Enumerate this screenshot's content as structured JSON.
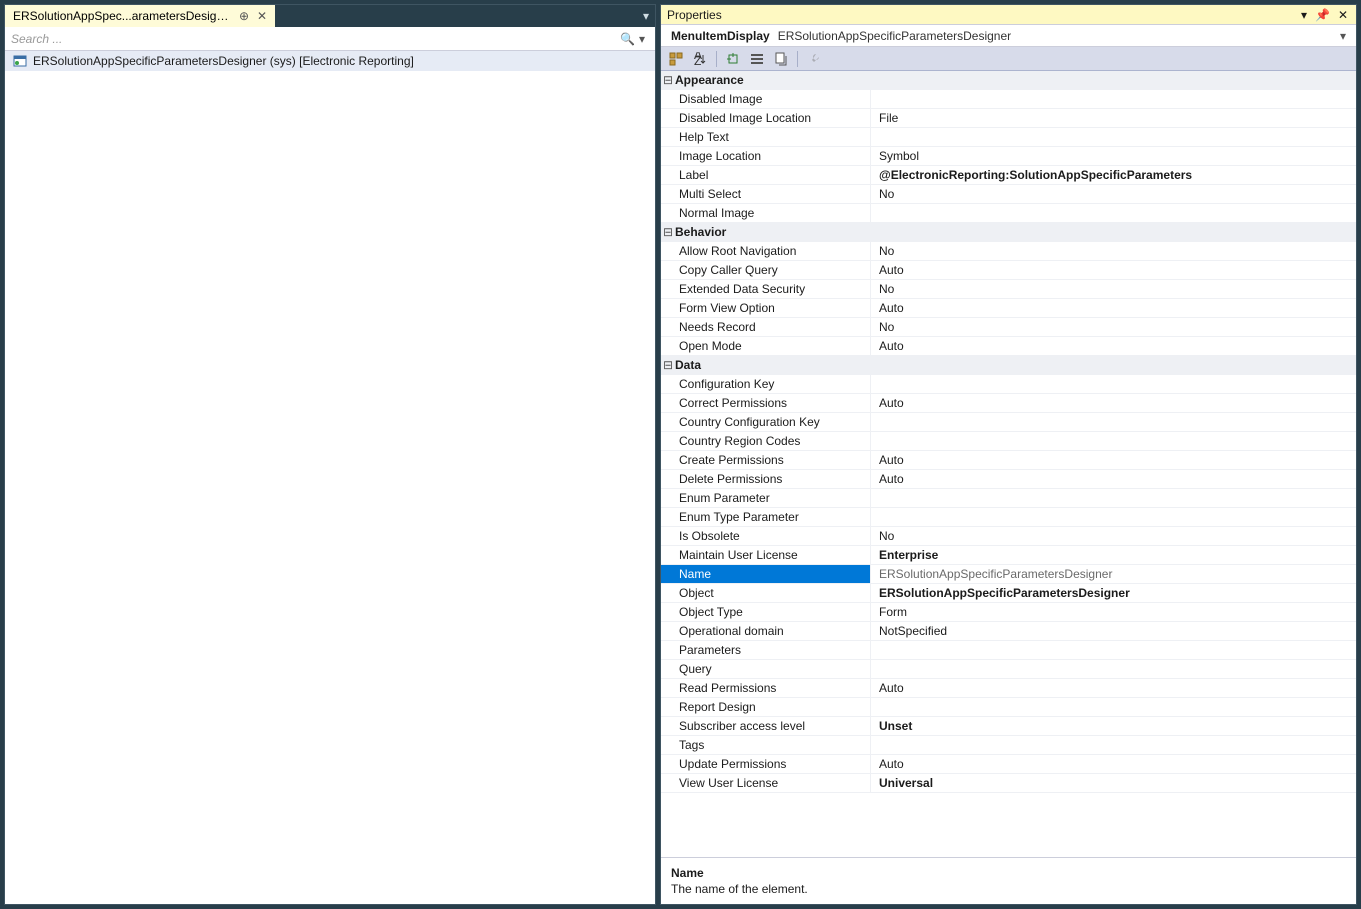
{
  "left": {
    "tab_title": "ERSolutionAppSpec...arametersDesigner",
    "search_placeholder": "Search ...",
    "tree_item": "ERSolutionAppSpecificParametersDesigner (sys) [Electronic Reporting]"
  },
  "props_title": "Properties",
  "hdr": {
    "type": "MenuItemDisplay",
    "name": "ERSolutionAppSpecificParametersDesigner"
  },
  "cats": [
    {
      "name": "Appearance",
      "rows": [
        {
          "k": "Disabled Image",
          "v": ""
        },
        {
          "k": "Disabled Image Location",
          "v": "File"
        },
        {
          "k": "Help Text",
          "v": ""
        },
        {
          "k": "Image Location",
          "v": "Symbol"
        },
        {
          "k": "Label",
          "v": "@ElectronicReporting:SolutionAppSpecificParameters",
          "b": true
        },
        {
          "k": "Multi Select",
          "v": "No"
        },
        {
          "k": "Normal Image",
          "v": ""
        }
      ]
    },
    {
      "name": "Behavior",
      "rows": [
        {
          "k": "Allow Root Navigation",
          "v": "No"
        },
        {
          "k": "Copy Caller Query",
          "v": "Auto"
        },
        {
          "k": "Extended Data Security",
          "v": "No"
        },
        {
          "k": "Form View Option",
          "v": "Auto"
        },
        {
          "k": "Needs Record",
          "v": "No"
        },
        {
          "k": "Open Mode",
          "v": "Auto"
        }
      ]
    },
    {
      "name": "Data",
      "rows": [
        {
          "k": "Configuration Key",
          "v": ""
        },
        {
          "k": "Correct Permissions",
          "v": "Auto"
        },
        {
          "k": "Country Configuration Key",
          "v": ""
        },
        {
          "k": "Country Region Codes",
          "v": ""
        },
        {
          "k": "Create Permissions",
          "v": "Auto"
        },
        {
          "k": "Delete Permissions",
          "v": "Auto"
        },
        {
          "k": "Enum Parameter",
          "v": ""
        },
        {
          "k": "Enum Type Parameter",
          "v": ""
        },
        {
          "k": "Is Obsolete",
          "v": "No"
        },
        {
          "k": "Maintain User License",
          "v": "Enterprise",
          "b": true
        },
        {
          "k": "Name",
          "v": "ERSolutionAppSpecificParametersDesigner",
          "sel": true
        },
        {
          "k": "Object",
          "v": "ERSolutionAppSpecificParametersDesigner",
          "b": true
        },
        {
          "k": "Object Type",
          "v": "Form"
        },
        {
          "k": "Operational domain",
          "v": "NotSpecified"
        },
        {
          "k": "Parameters",
          "v": ""
        },
        {
          "k": "Query",
          "v": ""
        },
        {
          "k": "Read Permissions",
          "v": "Auto"
        },
        {
          "k": "Report Design",
          "v": ""
        },
        {
          "k": "Subscriber access level",
          "v": "Unset",
          "b": true
        },
        {
          "k": "Tags",
          "v": ""
        },
        {
          "k": "Update Permissions",
          "v": "Auto"
        },
        {
          "k": "View User License",
          "v": "Universal",
          "b": true
        }
      ]
    }
  ],
  "desc": {
    "title": "Name",
    "text": "The name of the element."
  }
}
